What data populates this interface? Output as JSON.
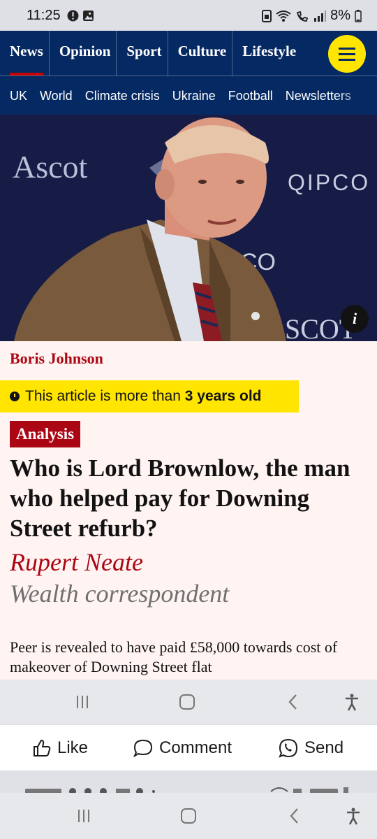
{
  "status_bar": {
    "time": "11:25",
    "battery": "8%",
    "icons": [
      "alert-icon",
      "image-icon",
      "sim-icon",
      "wifi-icon",
      "wifi-call-icon",
      "signal-icon",
      "battery-icon"
    ]
  },
  "nav": {
    "pillars": [
      "News",
      "Opinion",
      "Sport",
      "Culture",
      "Lifestyle"
    ],
    "active_pillar": "News",
    "subnav": [
      "UK",
      "World",
      "Climate crisis",
      "Ukraine",
      "Football",
      "Newsletters"
    ]
  },
  "hero": {
    "alt": "Ascot QIPCO backdrop with man in brown jacket",
    "backdrop_texts": [
      "Ascot",
      "QIPCO",
      "CO",
      "SCOT"
    ],
    "info_label": "i"
  },
  "article": {
    "series": "Boris Johnson",
    "age_prefix": "This article is more than ",
    "age_bold": "3 years old",
    "kicker": "Analysis",
    "headline": "Who is Lord Brownlow, the man who helped pay for Downing Street refurb?",
    "byline": "Rupert Neate",
    "role": "Wealth correspondent",
    "standfirst": "Peer is revealed to have paid £58,000 towards cost of makeover of Downing Street flat"
  },
  "facebook_actions": {
    "like": "Like",
    "comment": "Comment",
    "send": "Send"
  },
  "colors": {
    "guardian_blue": "#052962",
    "guardian_red": "#ab0613",
    "yellow": "#ffe500",
    "article_bg": "#fff4f2"
  }
}
